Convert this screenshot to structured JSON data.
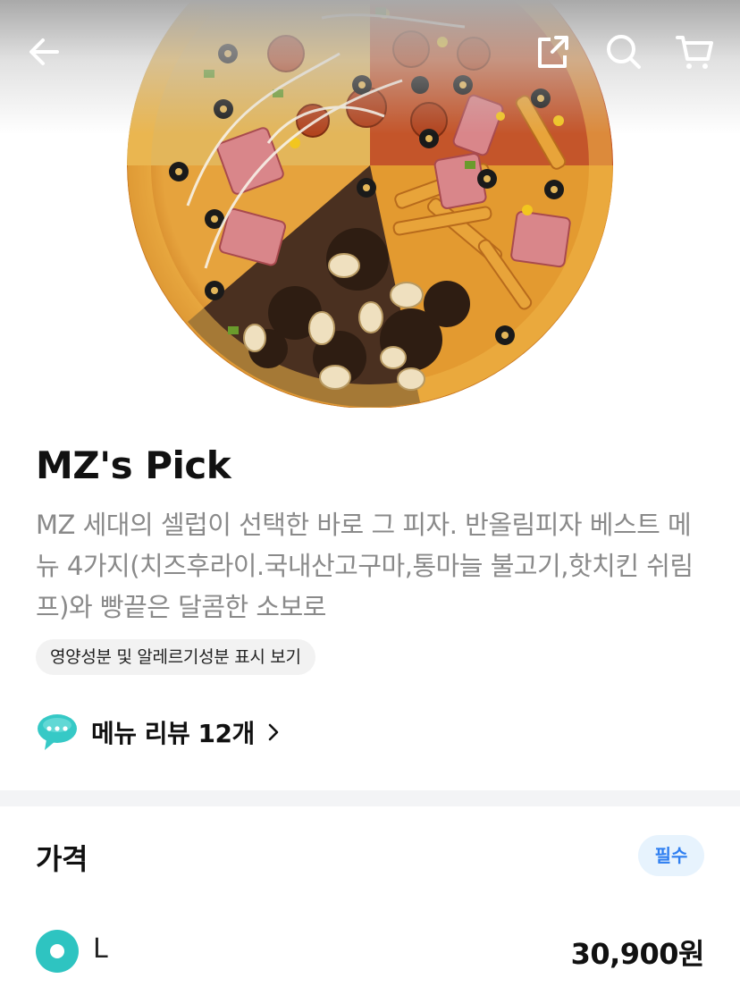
{
  "product": {
    "name": "MZ's Pick",
    "description": "MZ 세대의 셀럽이 선택한 바로 그 피자. 반올림피자 베스트 메뉴 4가지(치즈후라이.국내산고구마,통마늘 불고기,핫치킨 쉬림프)와 빵끝은 달콤한 소보로",
    "nutrition_link": "영양성분 및 알레르기성분 표시 보기",
    "review_link": "메뉴 리뷰 12개"
  },
  "price_section": {
    "title": "가격",
    "badge": "필수",
    "options": [
      {
        "label": "L",
        "price": "30,900원",
        "selected": true
      }
    ]
  },
  "icons": {
    "back": "arrow-left-icon",
    "share": "share-icon",
    "search": "search-icon",
    "cart": "cart-icon",
    "review": "speech-bubble-icon",
    "chevron": "chevron-right-icon"
  },
  "colors": {
    "accent_teal": "#2ec4c1",
    "badge_blue": "#2f7ff1",
    "badge_bg": "#e7f3fd",
    "description_gray": "#8a8a8a"
  }
}
